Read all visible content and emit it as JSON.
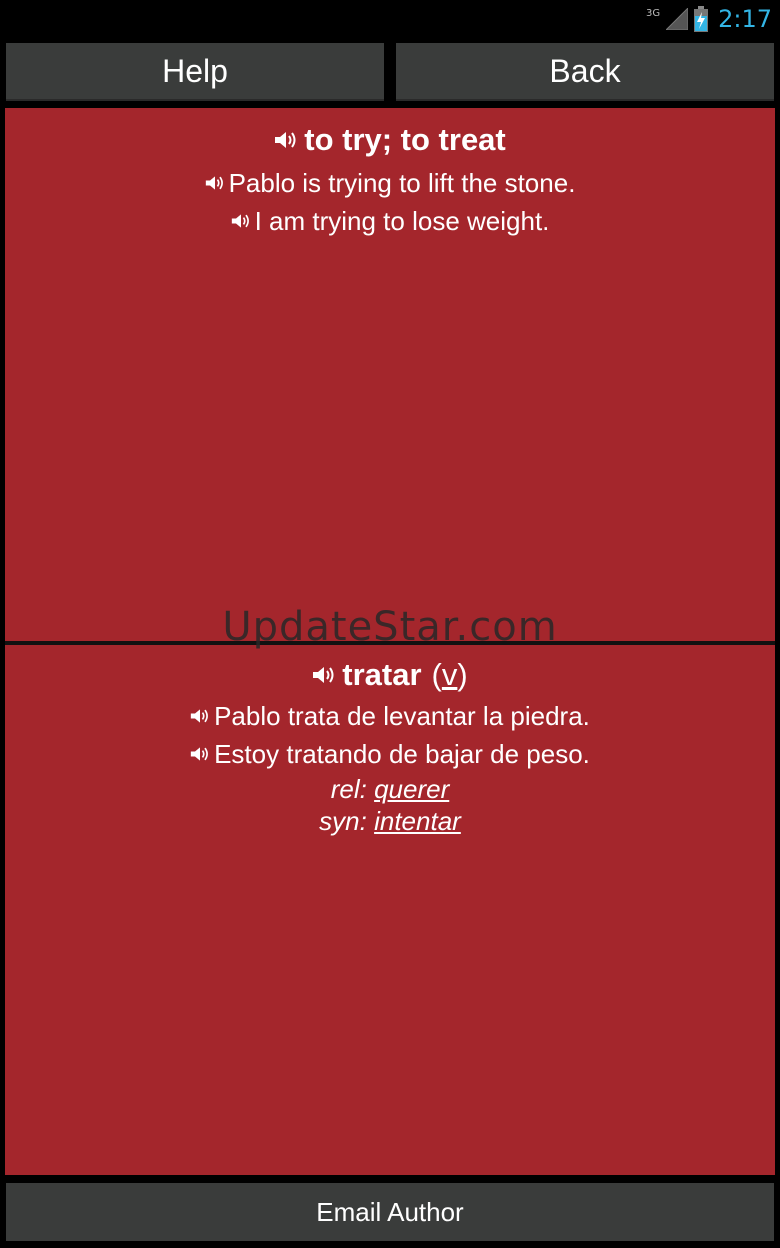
{
  "status_bar": {
    "network_type": "3G",
    "time": "2:17",
    "clock_color": "#33b5e5",
    "icons": [
      "signal-icon",
      "battery-icon"
    ]
  },
  "toolbar": {
    "help_label": "Help",
    "back_label": "Back"
  },
  "english_panel": {
    "headword": "to try; to treat",
    "examples": [
      "Pablo is trying to lift the stone.",
      "I am trying to lose weight."
    ]
  },
  "spanish_panel": {
    "headword": "tratar",
    "part_of_speech_open": "(",
    "part_of_speech": "v",
    "part_of_speech_close": ")",
    "examples": [
      "Pablo trata de levantar la piedra.",
      "Estoy tratando de bajar de peso."
    ],
    "related_label": "rel:",
    "related_word": "querer",
    "synonym_label": "syn:",
    "synonym_word": "intentar"
  },
  "watermark": "UpdateStar.com",
  "footer": {
    "email_label": "Email Author"
  },
  "colors": {
    "panel_background": "#a4262c",
    "button_background": "#3a3c3b"
  }
}
